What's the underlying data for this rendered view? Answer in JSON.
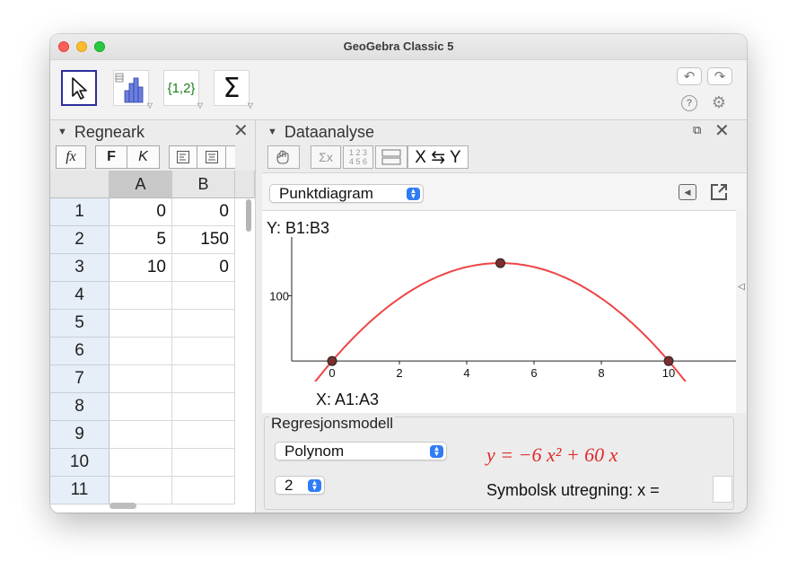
{
  "window": {
    "title": "GeoGebra Classic 5"
  },
  "toolbar": {
    "tools": [
      {
        "name": "move-tool",
        "icon": "cursor-arrow-icon"
      },
      {
        "name": "one-variable-analysis-tool",
        "icon": "histogram-icon"
      },
      {
        "name": "list-tool",
        "icon": "list-braces-icon",
        "label": "{1,2}"
      },
      {
        "name": "sum-tool",
        "icon": "sigma-icon",
        "label": "Σ"
      }
    ],
    "undo_icon": "undo-icon",
    "redo_icon": "redo-icon",
    "help_icon": "help-icon",
    "settings_icon": "gear-icon"
  },
  "spreadsheet": {
    "title": "Regneark",
    "format_buttons": {
      "fx": "fx",
      "bold": "F",
      "italic": "K"
    },
    "columns": [
      "A",
      "B"
    ],
    "rows": [
      {
        "n": "1",
        "A": "0",
        "B": "0"
      },
      {
        "n": "2",
        "A": "5",
        "B": "150"
      },
      {
        "n": "3",
        "A": "10",
        "B": "0"
      },
      {
        "n": "4",
        "A": "",
        "B": ""
      },
      {
        "n": "5",
        "A": "",
        "B": ""
      },
      {
        "n": "6",
        "A": "",
        "B": ""
      },
      {
        "n": "7",
        "A": "",
        "B": ""
      },
      {
        "n": "8",
        "A": "",
        "B": ""
      },
      {
        "n": "9",
        "A": "",
        "B": ""
      },
      {
        "n": "10",
        "A": "",
        "B": ""
      },
      {
        "n": "11",
        "A": "",
        "B": ""
      }
    ]
  },
  "data_analysis": {
    "title": "Dataanalyse",
    "swap_label": "X ⇆ Y",
    "stats_label": "Σx",
    "data_label": "1 2 3\n4 5 6",
    "plot_type": "Punktdiagram",
    "y_label": "Y:  B1:B3",
    "x_label": "X:  A1:A3",
    "regression": {
      "title": "Regresjonsmodell",
      "model": "Polynom",
      "degree": "2",
      "formula": "y = −6 x² + 60 x",
      "symbolic_label": "Symbolsk utregning:  x ="
    }
  },
  "chart_data": {
    "type": "scatter",
    "x": [
      0,
      5,
      10
    ],
    "y": [
      0,
      150,
      0
    ],
    "fit": {
      "type": "polynomial",
      "degree": 2,
      "coefficients": [
        -6,
        60,
        0
      ],
      "color": "#ee4444"
    },
    "x_ticks": [
      "0",
      "2",
      "4",
      "6",
      "8",
      "10"
    ],
    "y_ticks": [
      "100"
    ],
    "xlim": [
      -1.2,
      12
    ],
    "ylim": [
      -30,
      190
    ],
    "point_color": "#7a2f2f"
  }
}
